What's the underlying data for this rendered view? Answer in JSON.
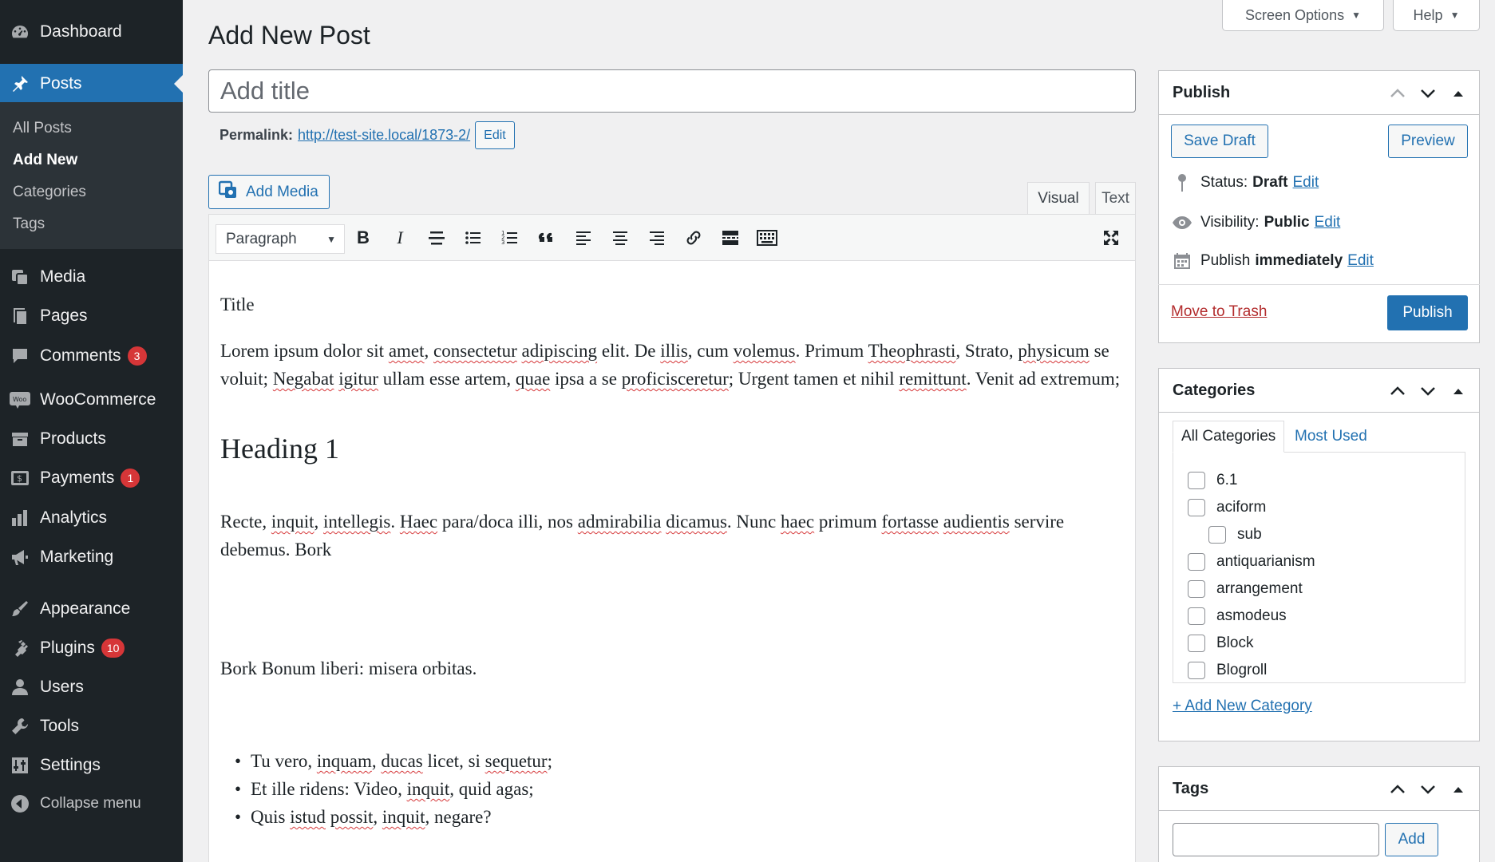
{
  "sidebar": {
    "dashboard": "Dashboard",
    "posts": "Posts",
    "submenu": [
      "All Posts",
      "Add New",
      "Categories",
      "Tags"
    ],
    "media": "Media",
    "pages": "Pages",
    "comments": "Comments",
    "comments_count": "3",
    "woocommerce": "WooCommerce",
    "products": "Products",
    "payments": "Payments",
    "payments_count": "1",
    "analytics": "Analytics",
    "marketing": "Marketing",
    "appearance": "Appearance",
    "plugins": "Plugins",
    "plugins_count": "10",
    "users": "Users",
    "tools": "Tools",
    "settings": "Settings",
    "collapse": "Collapse menu"
  },
  "header": {
    "screen_options": "Screen Options",
    "help": "Help",
    "page_title": "Add New Post"
  },
  "title_field": {
    "placeholder": "Add title",
    "value": ""
  },
  "permalink": {
    "label": "Permalink:",
    "url": "http://test-site.local/1873-2/",
    "edit": "Edit"
  },
  "editor": {
    "add_media": "Add Media",
    "tab_visual": "Visual",
    "tab_text": "Text",
    "format": "Paragraph",
    "content": {
      "p_title": "Title",
      "p1": [
        "Lorem ipsum dolor sit ",
        "amet",
        ", ",
        "consectetur",
        " ",
        "adipiscing",
        " elit. De ",
        "illis",
        ", cum ",
        "volemus",
        ". Primum ",
        "Theophrasti",
        ", Strato, ",
        "physicum",
        " se voluit; ",
        "Negabat",
        " ",
        "igitur",
        " ullam esse artem, ",
        "quae",
        " ipsa a se ",
        "proficisceretur",
        "; Urgent tamen et nihil ",
        "remittunt",
        ". Venit ad extremum;"
      ],
      "heading": "Heading 1",
      "p2": [
        "Recte, ",
        "inquit",
        ", ",
        "intellegis",
        ". ",
        "Haec",
        " para/doca illi, nos ",
        "admirabilia",
        " ",
        "dicamus",
        ". Nunc ",
        "haec",
        " primum ",
        "fortasse",
        " ",
        "audientis",
        " servire debemus. Bork"
      ],
      "p3": "Bork Bonum liberi: misera orbitas.",
      "list": [
        [
          "Tu vero, ",
          "inquam",
          ", ",
          "ducas",
          " licet, si ",
          "sequetur",
          ";"
        ],
        [
          "Et ille ridens: Video, ",
          "inquit",
          ", quid agas;"
        ],
        [
          "Quis ",
          "istud",
          " ",
          "possit",
          ", ",
          "inquit",
          ", negare?"
        ]
      ]
    }
  },
  "publish_box": {
    "title": "Publish",
    "save_draft": "Save Draft",
    "preview": "Preview",
    "status_label": "Status:",
    "status_value": "Draft",
    "visibility_label": "Visibility:",
    "visibility_value": "Public",
    "publish_label": "Publish",
    "publish_value": "immediately",
    "edit": "Edit",
    "move_to_trash": "Move to Trash",
    "publish_button": "Publish"
  },
  "categories_box": {
    "title": "Categories",
    "tab_all": "All Categories",
    "tab_most_used": "Most Used",
    "items": [
      "6.1",
      "aciform",
      "sub",
      "antiquarianism",
      "arrangement",
      "asmodeus",
      "Block",
      "Blogroll"
    ],
    "add_new": "+ Add New Category"
  },
  "tags_box": {
    "title": "Tags",
    "add": "Add",
    "input_value": ""
  },
  "colors": {
    "accent": "#2271b1",
    "sidebar_bg": "#1d2327",
    "badge": "#d63638",
    "trash": "#b32d2e"
  }
}
